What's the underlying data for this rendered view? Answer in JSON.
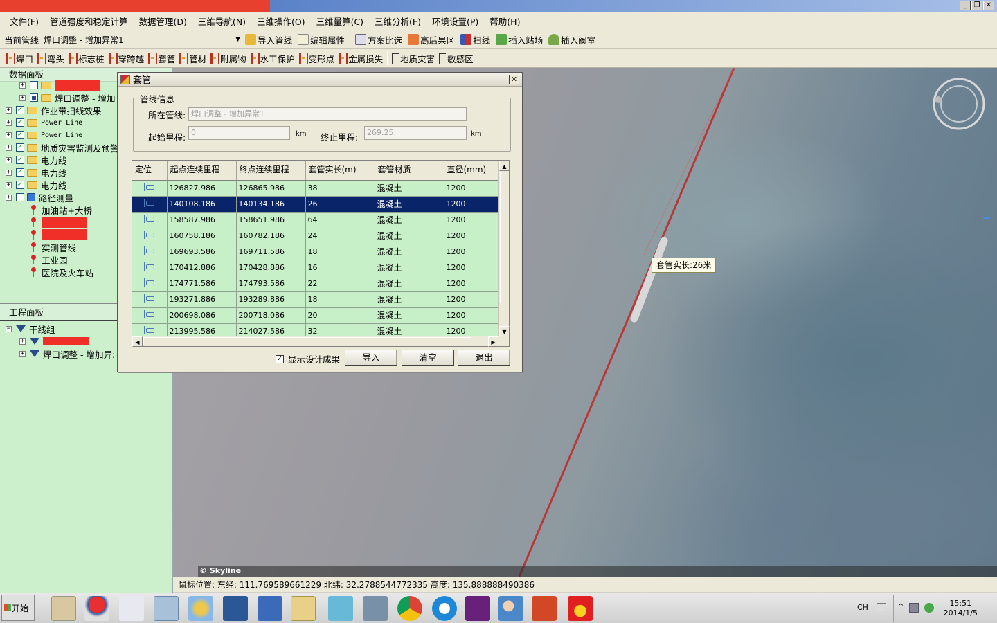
{
  "menu": [
    "文件(F)",
    "管道强度和稳定计算",
    "数据管理(D)",
    "三维导航(N)",
    "三维操作(O)",
    "三维量算(C)",
    "三维分析(F)",
    "环境设置(P)",
    "帮助(H)"
  ],
  "toolbar1": {
    "current_label": "当前管线",
    "current_value": "焊口调整 - 增加异常1",
    "buttons": [
      "导入管线",
      "编辑属性",
      "方案比选",
      "高后果区",
      "扫线",
      "插入站场",
      "插入阀室"
    ]
  },
  "toolbar2": {
    "buttons": [
      "焊口",
      "弯头",
      "标志桩",
      "穿跨越",
      "套管",
      "管材",
      "附属物",
      "水工保护",
      "变形点",
      "金属损失",
      "地质灾害",
      "敏感区"
    ]
  },
  "data_panel": {
    "title": "数据面板",
    "items": [
      {
        "label": "",
        "checked": false,
        "type": "folder",
        "indent": 1,
        "redacted": true
      },
      {
        "label": "焊口调整 - 增加",
        "checked": true,
        "type": "folder",
        "indent": 1
      },
      {
        "label": "作业带扫线效果",
        "checked": true,
        "type": "folder",
        "indent": 0
      },
      {
        "label": "Power Line",
        "checked": true,
        "type": "folder",
        "indent": 0
      },
      {
        "label": "Power Line",
        "checked": true,
        "type": "folder",
        "indent": 0
      },
      {
        "label": "地质灾害监测及预警",
        "checked": true,
        "type": "folder",
        "indent": 0
      },
      {
        "label": "电力线",
        "checked": true,
        "type": "folder",
        "indent": 0
      },
      {
        "label": "电力线",
        "checked": true,
        "type": "folder",
        "indent": 0
      },
      {
        "label": "电力线",
        "checked": true,
        "type": "folder",
        "indent": 0
      },
      {
        "label": "路径测量",
        "checked": false,
        "type": "cube",
        "indent": 0
      },
      {
        "label": "加油站+大桥",
        "type": "pin",
        "indent": 1
      },
      {
        "label": "",
        "type": "pin",
        "indent": 1,
        "redacted": true
      },
      {
        "label": "",
        "type": "pin",
        "indent": 1,
        "redacted": true
      },
      {
        "label": "实测管线",
        "type": "pin",
        "indent": 1
      },
      {
        "label": "工业园",
        "type": "pin",
        "indent": 1
      },
      {
        "label": "医院及火车站",
        "type": "pin",
        "indent": 1
      }
    ]
  },
  "project_panel": {
    "title": "工程面板",
    "items": [
      {
        "label": "干线组",
        "indent": 0
      },
      {
        "label": "",
        "indent": 1,
        "redacted": true
      },
      {
        "label": "焊口调整 - 增加异:",
        "indent": 1
      }
    ]
  },
  "dialog": {
    "title": "套管",
    "group_title": "管线信息",
    "pipeline_label": "所在管线:",
    "pipeline_value": "焊口调整 - 增加异常1",
    "start_label": "起始里程:",
    "start_value": "0",
    "start_unit": "km",
    "end_label": "终止里程:",
    "end_value": "269.25",
    "end_unit": "km",
    "columns": [
      "定位",
      "起点连续里程",
      "终点连续里程",
      "套管实长(m)",
      "套管材质",
      "直径(mm)"
    ],
    "rows": [
      {
        "start": "126827.986",
        "end": "126865.986",
        "len": "38",
        "mat": "混凝土",
        "dia": "1200"
      },
      {
        "start": "140108.186",
        "end": "140134.186",
        "len": "26",
        "mat": "混凝土",
        "dia": "1200",
        "selected": true
      },
      {
        "start": "158587.986",
        "end": "158651.986",
        "len": "64",
        "mat": "混凝土",
        "dia": "1200"
      },
      {
        "start": "160758.186",
        "end": "160782.186",
        "len": "24",
        "mat": "混凝土",
        "dia": "1200"
      },
      {
        "start": "169693.586",
        "end": "169711.586",
        "len": "18",
        "mat": "混凝土",
        "dia": "1200"
      },
      {
        "start": "170412.886",
        "end": "170428.886",
        "len": "16",
        "mat": "混凝土",
        "dia": "1200"
      },
      {
        "start": "174771.586",
        "end": "174793.586",
        "len": "22",
        "mat": "混凝土",
        "dia": "1200"
      },
      {
        "start": "193271.886",
        "end": "193289.886",
        "len": "18",
        "mat": "混凝土",
        "dia": "1200"
      },
      {
        "start": "200698.086",
        "end": "200718.086",
        "len": "20",
        "mat": "混凝土",
        "dia": "1200"
      },
      {
        "start": "213995.586",
        "end": "214027.586",
        "len": "32",
        "mat": "混凝土",
        "dia": "1200"
      }
    ],
    "show_design_label": "显示设计成果",
    "show_design_checked": true,
    "btn_import": "导入",
    "btn_clear": "清空",
    "btn_exit": "退出"
  },
  "map": {
    "callout": "套管实长:26米",
    "copyright": "© Skyline"
  },
  "status": {
    "text": "鼠标位置: 东经: 111.769589661229  北纬: 32.2788544772335  高度: 135.888888490386"
  },
  "taskbar": {
    "start_label": "开始",
    "lang": "CH",
    "time": "15:51",
    "date": "2014/1/5"
  },
  "colors": {
    "panel_green": "#ccefcc",
    "grid_green": "#c8f0c8",
    "selection": "#0a246a",
    "pipeline": "#b83838"
  }
}
